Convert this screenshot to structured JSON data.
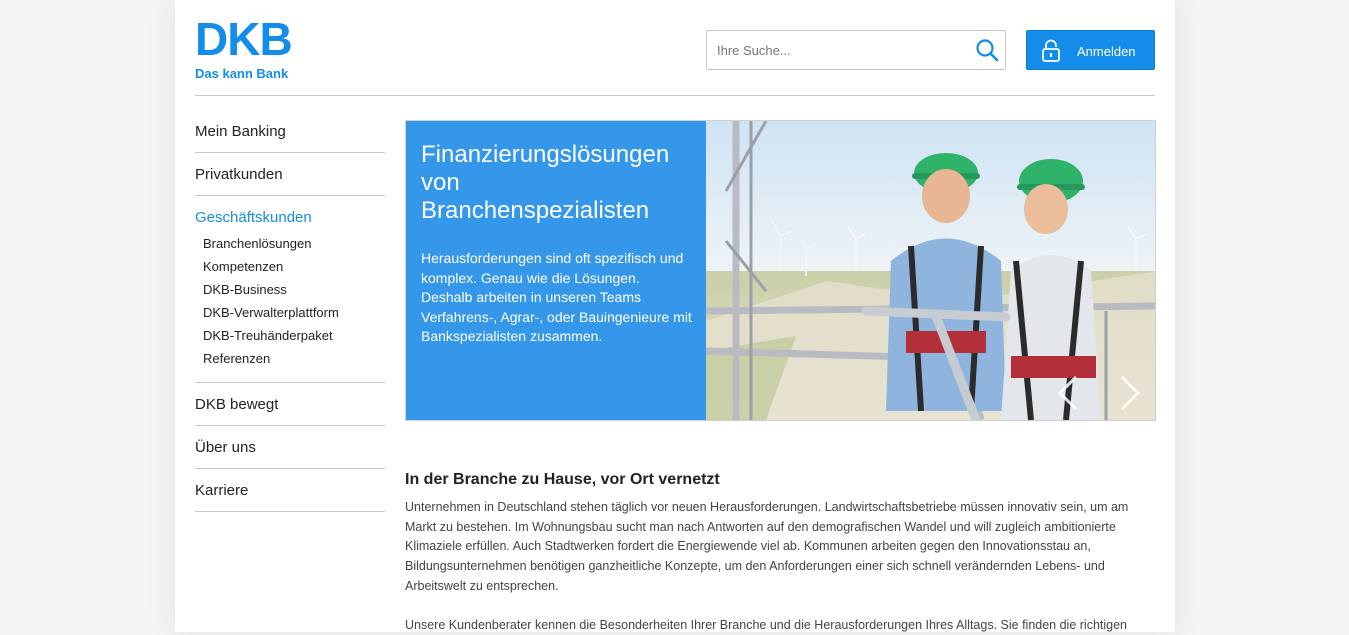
{
  "header": {
    "logo_word": "DKB",
    "logo_claim": "Das kann Bank",
    "search_placeholder": "Ihre Suche...",
    "login_label": "Anmelden"
  },
  "colors": {
    "brand": "#148dea",
    "hero_panel": "#3497ea"
  },
  "icons": {
    "search": "search-icon",
    "login": "lock-icon",
    "next": "chevron-right-icon",
    "prev": "chevron-left-icon"
  },
  "sidebar": {
    "items": [
      {
        "label": "Mein Banking"
      },
      {
        "label": "Privatkunden"
      },
      {
        "label": "Geschäftskunden",
        "active": true
      },
      {
        "label": "DKB bewegt"
      },
      {
        "label": "Über uns"
      },
      {
        "label": "Karriere"
      }
    ],
    "subitems": [
      {
        "label": "Branchenlösungen"
      },
      {
        "label": "Kompetenzen"
      },
      {
        "label": "DKB-Business"
      },
      {
        "label": "DKB-Verwalterplattform"
      },
      {
        "label": "DKB-Treuhänderpaket"
      },
      {
        "label": "Referenzen"
      }
    ]
  },
  "hero": {
    "title_line1": "Finanzierungslösungen",
    "title_line2": "von Branchenspezialisten",
    "body": "Herausforderungen sind oft spezifisch und komplex. Genau wie die Lösungen. Deshalb arbeiten in unseren Teams Verfahrens-, Agrar-, oder Bauingenieure mit Bankspezialisten zusammen."
  },
  "article": {
    "heading": "In der Branche zu Hause, vor Ort vernetzt",
    "paragraph1": "Unternehmen in Deutschland stehen täglich vor neuen Herausforderungen. Landwirtschaftsbetriebe müssen innovativ sein, um am Markt zu bestehen. Im Wohnungsbau sucht man nach Antworten auf den demografischen Wandel und will zugleich ambitionierte Klimaziele erfüllen. Auch Stadtwerken fordert die Energiewende viel ab. Kommunen arbeiten gegen den Innovationsstau an, Bildungsunternehmen benötigen ganzheitliche Konzepte, um den Anforderungen einer sich schnell verändernden Lebens- und Arbeitswelt zu entsprechen.",
    "paragraph2": "Unsere Kundenberater kennen die Besonderheiten Ihrer Branche und die Herausforderungen Ihres Alltags. Sie finden die richtigen"
  }
}
